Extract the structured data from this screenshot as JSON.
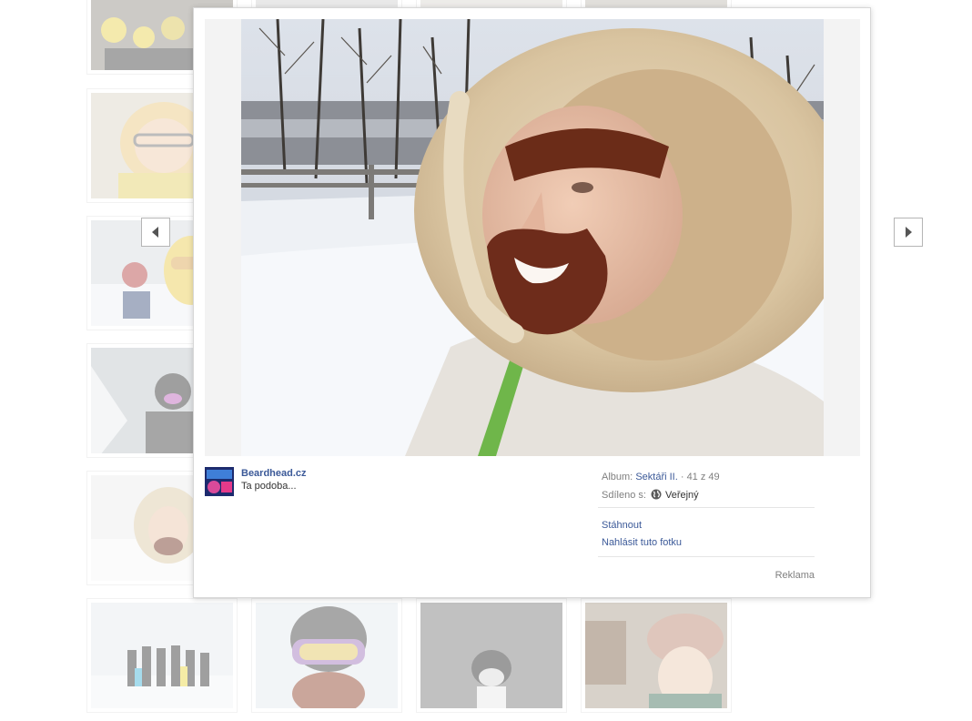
{
  "viewer": {
    "owner_name": "Beardhead.cz",
    "caption": "Ta podoba...",
    "album_label": "Album:",
    "album_name": "Sektáři II.",
    "position": "· 41 z 49",
    "shared_label": "Sdíleno s:",
    "audience": "Veřejný",
    "download": "Stáhnout",
    "report": "Nahlásit tuto fotku",
    "sponsored": "Reklama",
    "photo_subject": "person-in-fur-hood-knitted-beard-photo"
  },
  "nav": {
    "prev_icon": "arrow-left-icon",
    "next_icon": "arrow-right-icon"
  },
  "colors": {
    "link": "#3b5998",
    "muted": "#7f7f7f",
    "border": "#d7d7d7"
  }
}
